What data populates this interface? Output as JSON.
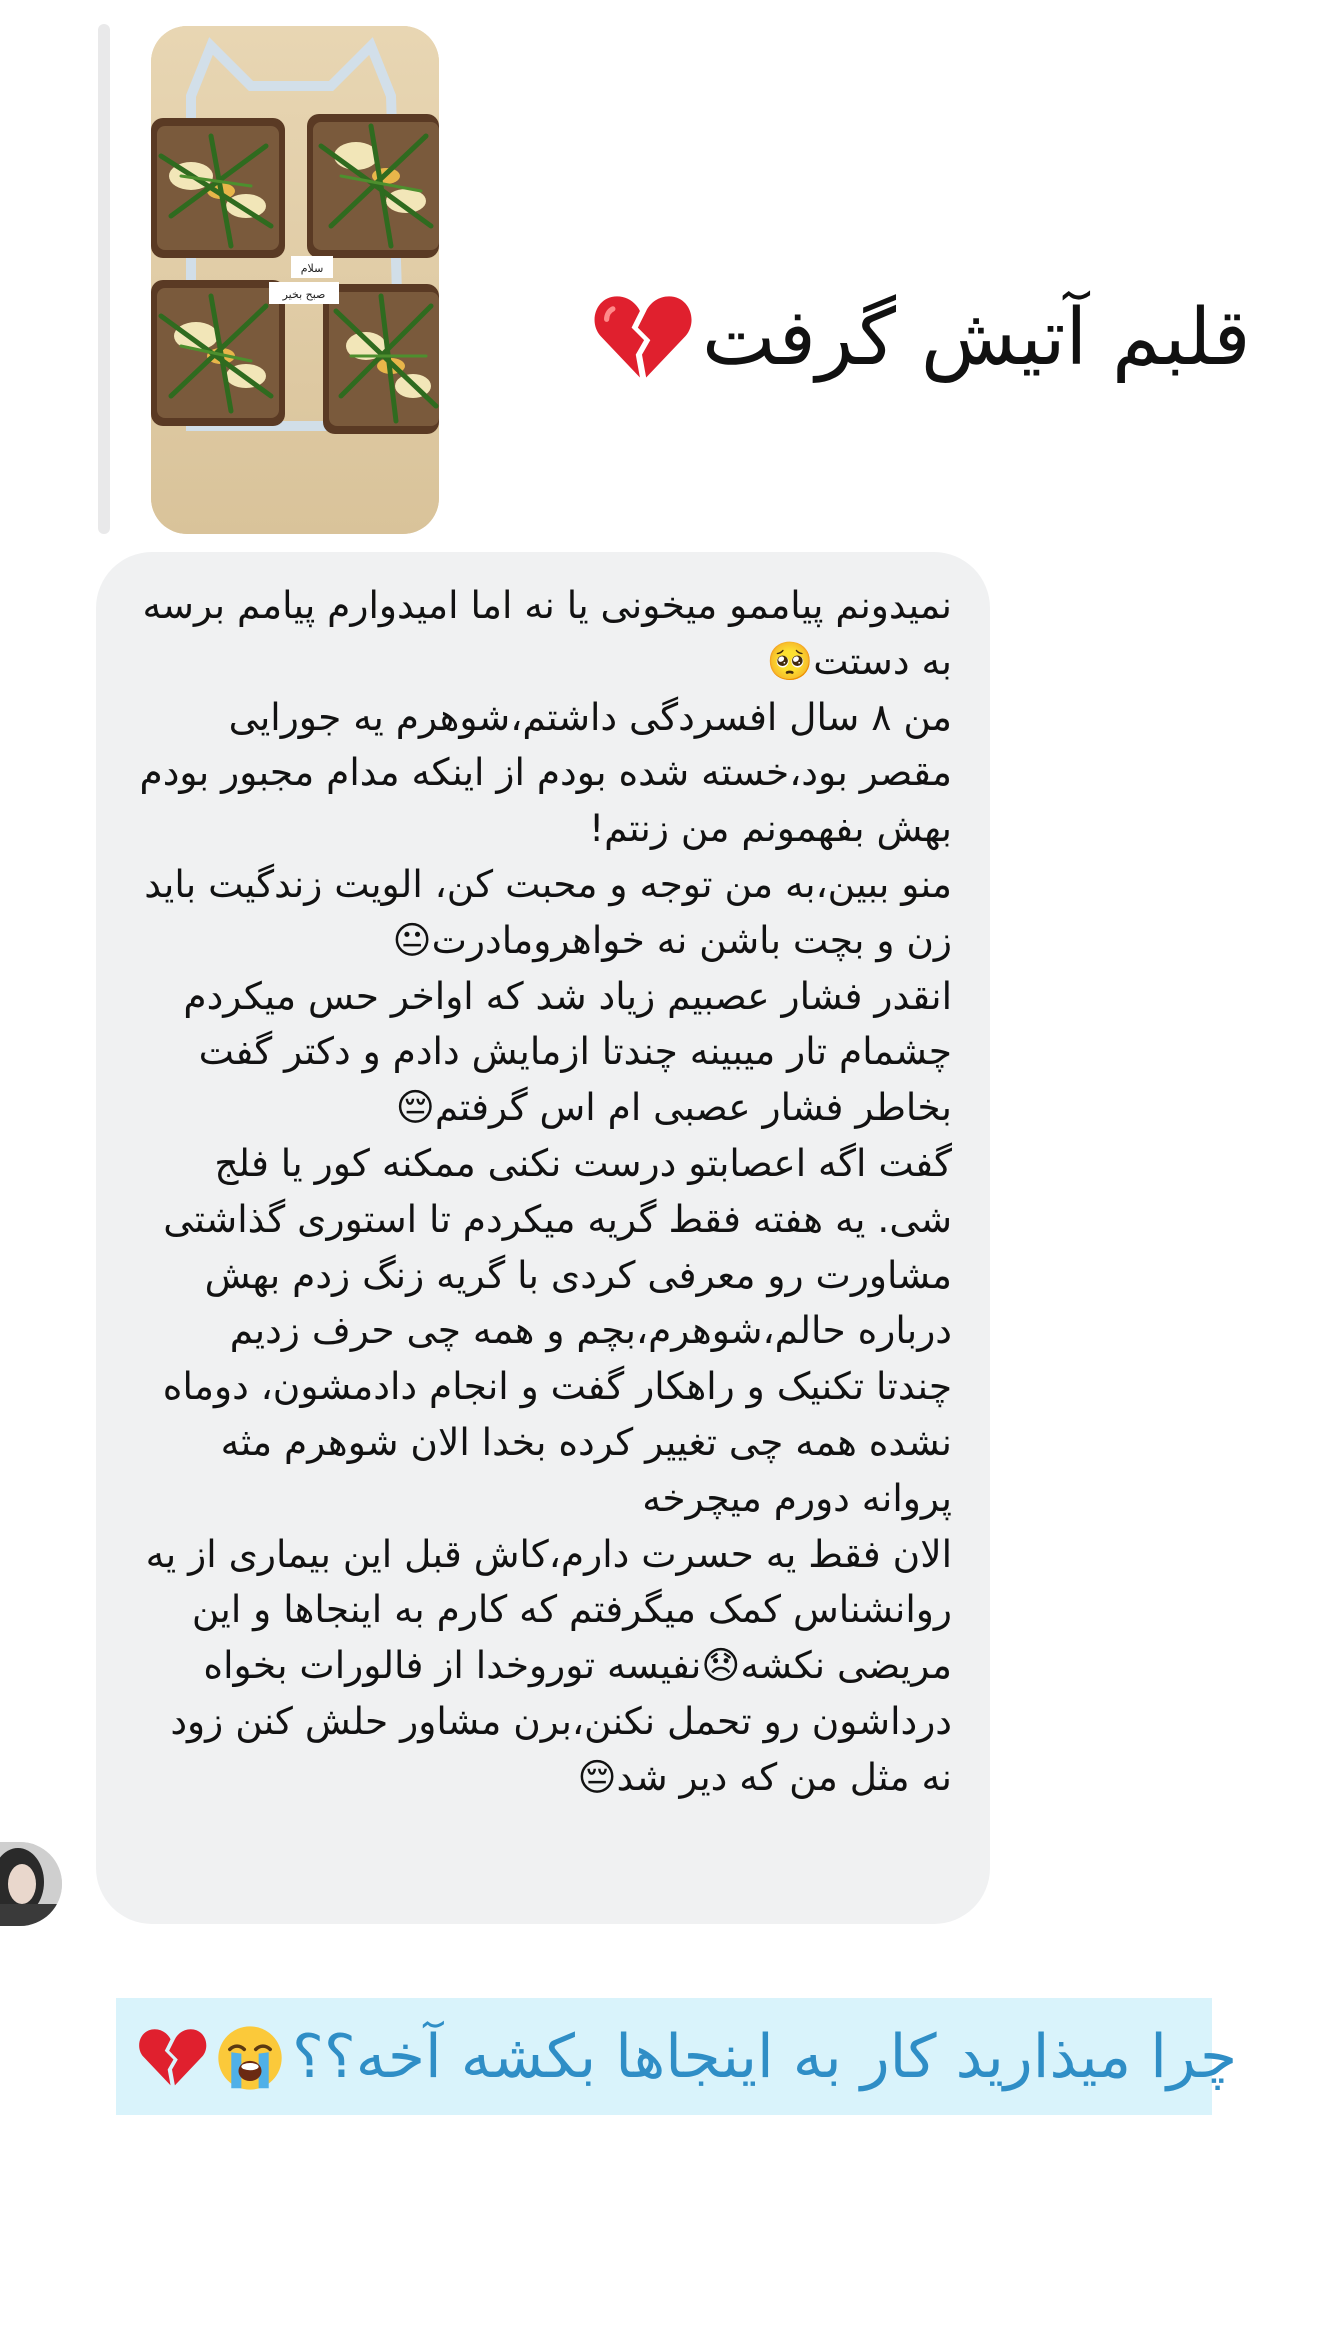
{
  "story_reply": {
    "thumbnail_label": "story-image",
    "thumb_caption_line1": "سلام",
    "thumb_caption_line2": "صبح بخیر"
  },
  "headline": {
    "text": "قلبم آتیش گرفت",
    "emoji": "broken-heart"
  },
  "message": {
    "text": "نمیدونم پیاممو میخونی یا نه اما امیدوارم پیامم برسه به دستت🥺\nمن ۸ سال افسردگی داشتم،شوهرم یه جورایی مقصر بود،خسته شده بودم از اینکه مدام مجبور بودم بهش بفهمونم من زنتم!\nمنو ببین،به من توجه و محبت کن، الویت زندگیت باید زن و بچت باشن نه خواهرومادرت😐\nانقدر فشار عصبیم زیاد شد که اواخر حس میکردم چشمام تار میبینه چندتا ازمایش دادم و دکتر گفت بخاطر فشار عصبی ام اس گرفتم😔\nگفت اگه اعصابتو درست نکنی ممکنه کور یا فلج شی. یه هفته فقط گریه میکردم تا استوری گذاشتی مشاورت رو معرفی کردی با گریه زنگ زدم بهش درباره حالم،شوهرم،بچم و همه چی حرف زدیم\nچندتا تکنیک و راهکار گفت و انجام دادمشون، دوماه نشده همه چی تغییر کرده بخدا الان شوهرم مثه پروانه دورم میچرخه\nالان فقط یه حسرت دارم،کاش قبل این بیماری از یه روانشناس کمک میگرفتم که کارم به اینجاها و این مریضی نکشه😞نفیسه توروخدا از فالورات بخواه درداشون رو تحمل نکنن،برن مشاور حلش کنن زود نه مثل من که دیر شد😔"
  },
  "sender": {
    "avatar_label": "sender-avatar"
  },
  "caption": {
    "text": "چرا میذارید کار به اینجاها بکشه آخه؟؟",
    "emojis": [
      "loudly-crying-face",
      "broken-heart"
    ]
  },
  "colors": {
    "bubble": "#f0f1f2",
    "caption_background": "#d9f3fb",
    "caption_text": "#2f8ec6",
    "heart": "#e0202e"
  }
}
